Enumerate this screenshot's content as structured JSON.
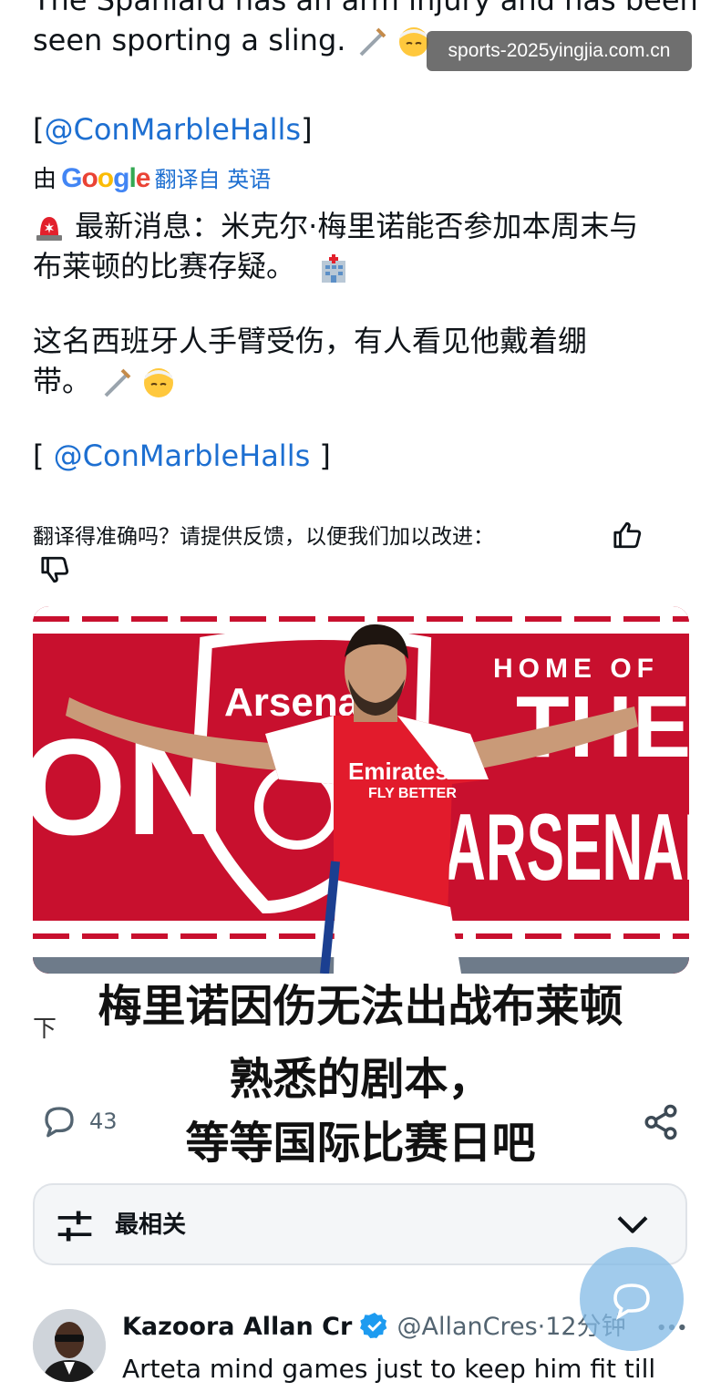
{
  "watermark": "sports-2025yingjia.com.cn",
  "original": {
    "line1": "The Spaniard has an arm injury and has been",
    "line2": "seen sporting a sling.",
    "mention": "@ConMarbleHalls"
  },
  "translation": {
    "prefix": "由",
    "google": "Google",
    "suffix": "翻译自 英语",
    "news_line1": "最新消息：米克尔·梅里诺能否参加本周末与",
    "news_line2": "布莱顿的比赛存疑。",
    "injury_line1": "这名西班牙人手臂受伤，有人看见他戴着绷",
    "injury_line2": "带。",
    "mention": "@ConMarbleHalls"
  },
  "feedback": {
    "question": "翻译得准确吗？请提供反馈，以便我们加以改进："
  },
  "photo": {
    "banner_home_of": "HOME OF",
    "banner_the": "THE",
    "banner_arsenal": "ARSENAL",
    "crest_text": "Arsenal",
    "shirt_sponsor": "Emirates",
    "shirt_slogan": "FLY BETTER",
    "left_letters": "ON"
  },
  "caption": {
    "line1": "梅里诺因伤无法出战布莱顿",
    "line2": "熟悉的剧本，",
    "line3": "等等国际比赛日吧",
    "partial_left": "下"
  },
  "actions": {
    "reply_count": "43"
  },
  "sort": {
    "label": "最相关"
  },
  "reply": {
    "name": "Kazoora Allan Cr",
    "handle": "@AllanCres",
    "dot": "·",
    "time": "12分钟",
    "text": "Arteta mind games just to keep him fit till"
  },
  "colors": {
    "link": "#1d6fd1",
    "verified": "#1d9bf0",
    "arsenal_red": "#c8102e"
  }
}
